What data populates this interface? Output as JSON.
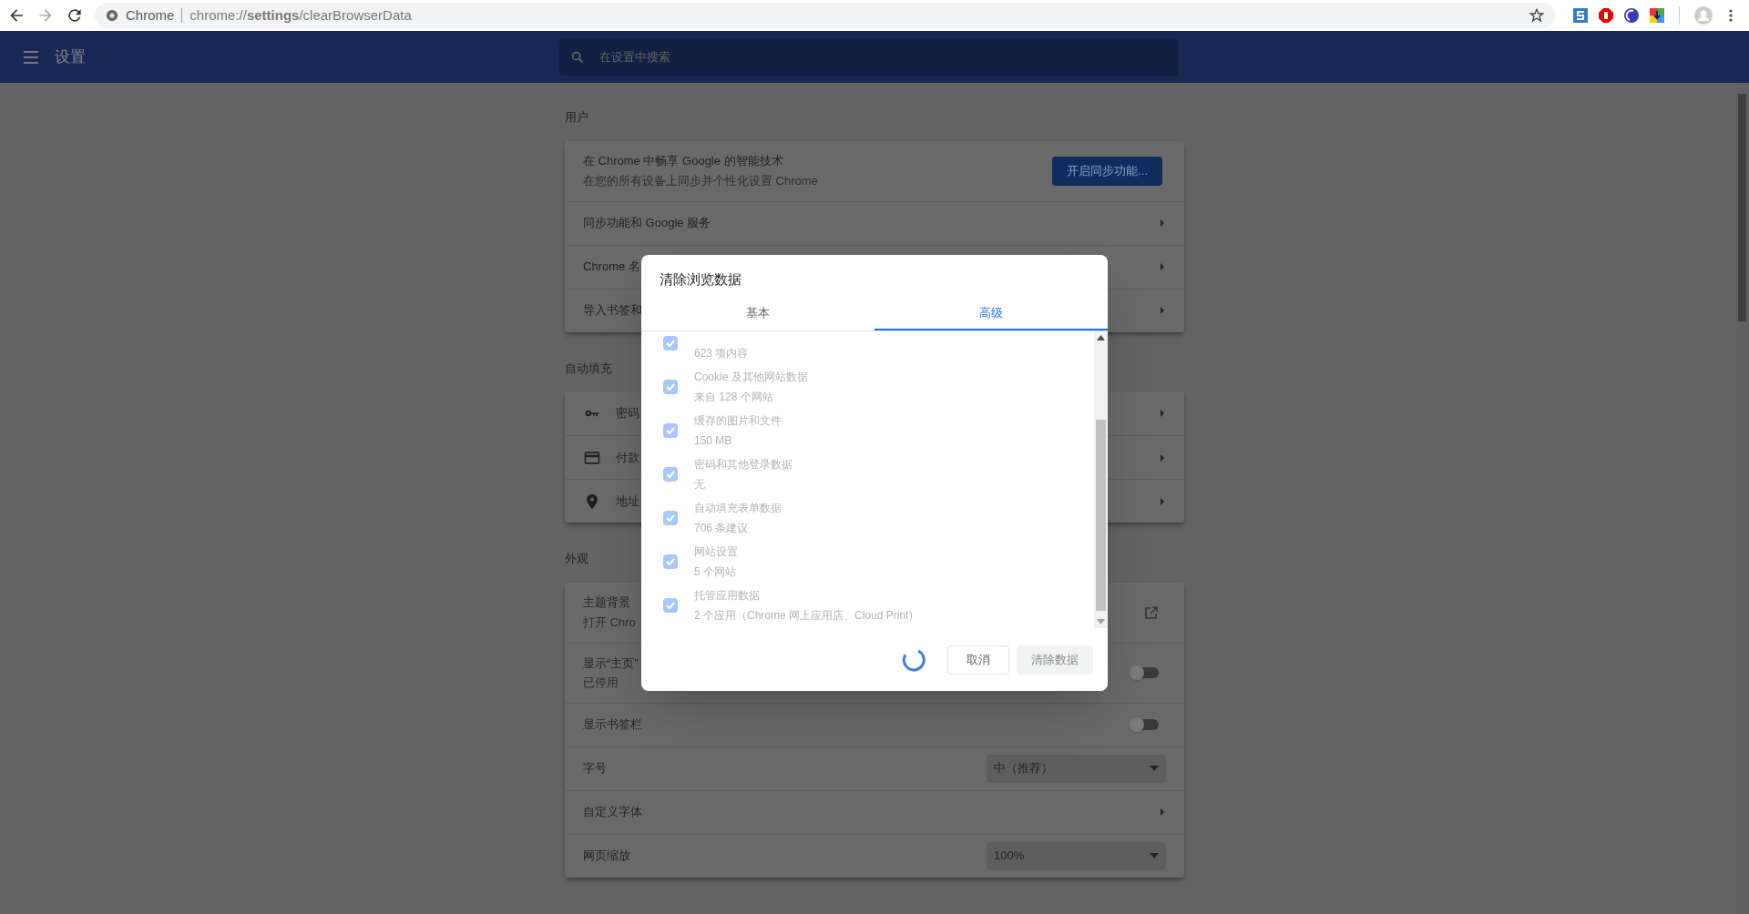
{
  "browser": {
    "site_label": "Chrome",
    "url": "chrome://**settings**/clearBrowserData"
  },
  "header": {
    "title": "设置",
    "search": {
      "placeholder": "在设置中搜索"
    }
  },
  "sections": [
    {
      "title": "用户",
      "rows": [
        {
          "kind": "promo",
          "label": "在 Chrome 中畅享 Google 的智能技术",
          "sublabel": "在您的所有设备上同步并个性化设置 Chrome",
          "button": "开启同步功能..."
        },
        {
          "kind": "link",
          "label": "同步功能和 Google 服务"
        },
        {
          "kind": "link",
          "label": "Chrome 名"
        },
        {
          "kind": "link",
          "label": "导入书签和"
        }
      ]
    },
    {
      "title": "自动填充",
      "rows": [
        {
          "kind": "icon-link",
          "label": "密码"
        },
        {
          "kind": "icon-link",
          "label": "付款"
        },
        {
          "kind": "icon-link",
          "label": "地址"
        }
      ]
    },
    {
      "title": "外观",
      "rows": [
        {
          "kind": "external",
          "label": "主题背景",
          "sublabel": "打开 Chro"
        },
        {
          "kind": "toggle",
          "label": "显示“主页”",
          "sublabel": "已停用",
          "on": false
        },
        {
          "kind": "toggle",
          "label": "显示书签栏",
          "on": false
        },
        {
          "kind": "select",
          "label": "字号",
          "value": "中（推荐）"
        },
        {
          "kind": "link",
          "label": "自定义字体"
        },
        {
          "kind": "select",
          "label": "网页缩放",
          "value": "100%"
        }
      ]
    }
  ],
  "dialog": {
    "title": "清除浏览数据",
    "tabs": [
      {
        "label": "基本",
        "selected": false
      },
      {
        "label": "高级",
        "selected": true
      }
    ],
    "items": [
      {
        "detail": "623 项内容",
        "checked": true
      },
      {
        "label": "Cookie 及其他网站数据",
        "detail": "来自 128 个网站",
        "checked": true
      },
      {
        "label": "缓存的图片和文件",
        "detail": "150 MB",
        "checked": true
      },
      {
        "label": "密码和其他登录数据",
        "detail": "无",
        "checked": true
      },
      {
        "label": "自动填充表单数据",
        "detail": "706 条建议",
        "checked": true
      },
      {
        "label": "网站设置",
        "detail": "5 个网站",
        "checked": true
      },
      {
        "label": "托管应用数据",
        "detail": "2 个应用（Chrome 网上应用店、Cloud Print）",
        "checked": true
      }
    ],
    "busy": true,
    "buttons": [
      {
        "label": "取消",
        "kind": "cancel"
      },
      {
        "label": "清除数据",
        "kind": "confirm"
      }
    ]
  }
}
